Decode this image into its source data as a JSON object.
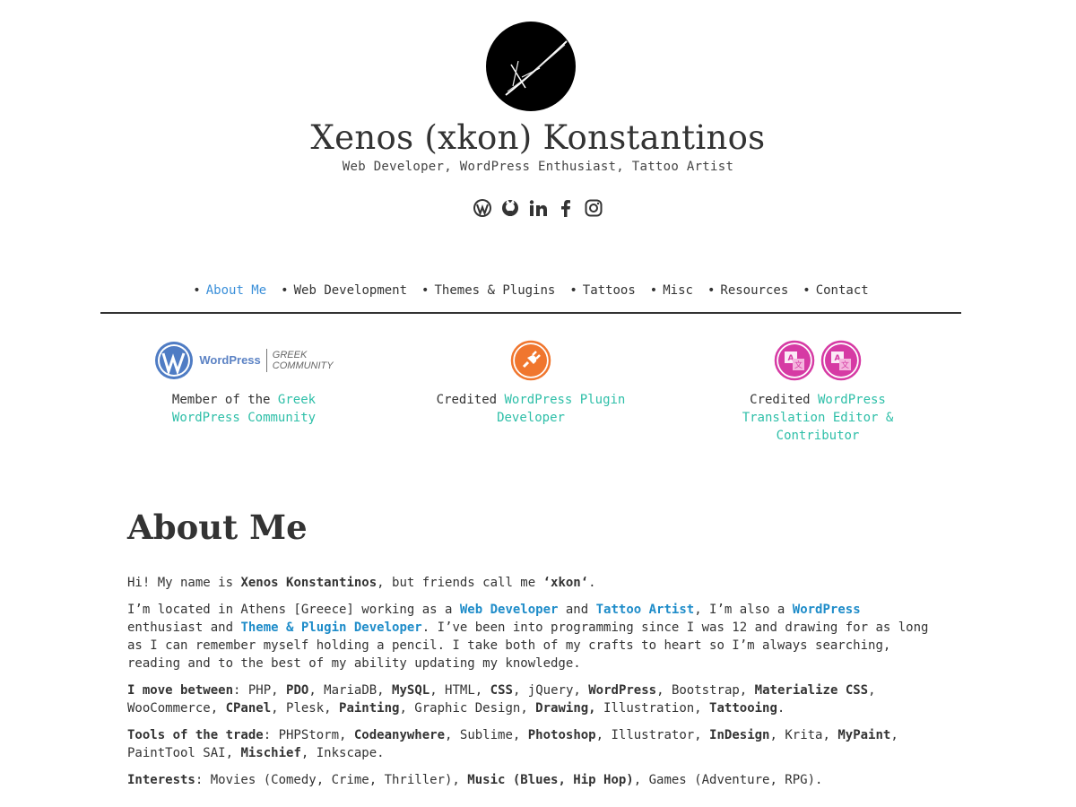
{
  "site": {
    "title": "Xenos (xkon) Konstantinos",
    "tagline": "Web Developer, WordPress Enthusiast, Tattoo Artist"
  },
  "socials": [
    {
      "icon": "wordpress-icon"
    },
    {
      "icon": "github-icon"
    },
    {
      "icon": "linkedin-icon"
    },
    {
      "icon": "facebook-icon"
    },
    {
      "icon": "instagram-icon"
    }
  ],
  "nav": {
    "items": [
      {
        "label": "About Me",
        "active": true
      },
      {
        "label": "Web Development"
      },
      {
        "label": "Themes & Plugins"
      },
      {
        "label": "Tattoos"
      },
      {
        "label": "Misc"
      },
      {
        "label": "Resources"
      },
      {
        "label": "Contact"
      }
    ],
    "bullet": "•"
  },
  "badges": [
    {
      "logo_word": "WordPress",
      "logo_sub1": "GREEK",
      "logo_sub2": "COMMUNITY",
      "prefix": "Member of the ",
      "link": "Greek WordPress Community"
    },
    {
      "prefix": "Credited ",
      "link": "WordPress Plugin Developer"
    },
    {
      "prefix": "Credited ",
      "link": "WordPress Translation Editor & Contributor"
    }
  ],
  "about": {
    "title": "About Me",
    "p1": {
      "t1": "Hi! My name is ",
      "b1": "Xenos Konstantinos",
      "t2": ", but friends call me ",
      "b2": "‘xkon‘",
      "t3": "."
    },
    "p2": {
      "t1": "I’m located in Athens [Greece] working as a ",
      "l1": "Web Developer",
      "t2": " and ",
      "l2": "Tattoo Artist",
      "t3": ", I’m also a ",
      "l3": "WordPress",
      "t4": " enthusiast and ",
      "l4": "Theme & Plugin Developer",
      "t5": ". I’ve been into programming since I was 12 and drawing for as long as I can remember myself holding a pencil. I take both of my crafts to heart so I’m always searching, reading and to the best of my ability updating my knowledge."
    },
    "p3": {
      "label": "I move between",
      "t1": ": PHP, ",
      "b1": "PDO",
      "t2": ", MariaDB, ",
      "b2": "MySQL",
      "t3": ", HTML, ",
      "b3": "CSS",
      "t4": ", jQuery, ",
      "b4": "WordPress",
      "t5": ", Bootstrap, ",
      "b5": "Materialize CSS",
      "t6": ", WooCommerce, ",
      "b6": "CPanel",
      "t7": ", Plesk, ",
      "b7": "Painting",
      "t8": ", Graphic Design, ",
      "b8": "Drawing,",
      "t9": " Illustration, ",
      "b9": "Tattooing",
      "t10": "."
    },
    "p4": {
      "label": "Tools of the trade",
      "t1": ": PHPStorm, ",
      "b1": "Codeanywhere",
      "t2": ", Sublime, ",
      "b2": "Photoshop",
      "t3": ", Illustrator, ",
      "b3": "InDesign",
      "t4": ", Krita, ",
      "b4": "MyPaint",
      "t5": ", PaintTool SAI, ",
      "b5": "Mischief",
      "t6": ", Inkscape."
    },
    "p5": {
      "label": "Interests",
      "t1": ": Movies (Comedy, Crime, Thriller), ",
      "b1": "Music (Blues, Hip Hop)",
      "t2": ", Games (Adventure, RPG)."
    }
  },
  "colors": {
    "accent_blue": "#3a8fd9",
    "link_teal": "#2ebfa8",
    "bold_link_blue": "#1e8cc9",
    "plugin_orange": "#f0762e",
    "translate_pink": "#d63aa4"
  }
}
